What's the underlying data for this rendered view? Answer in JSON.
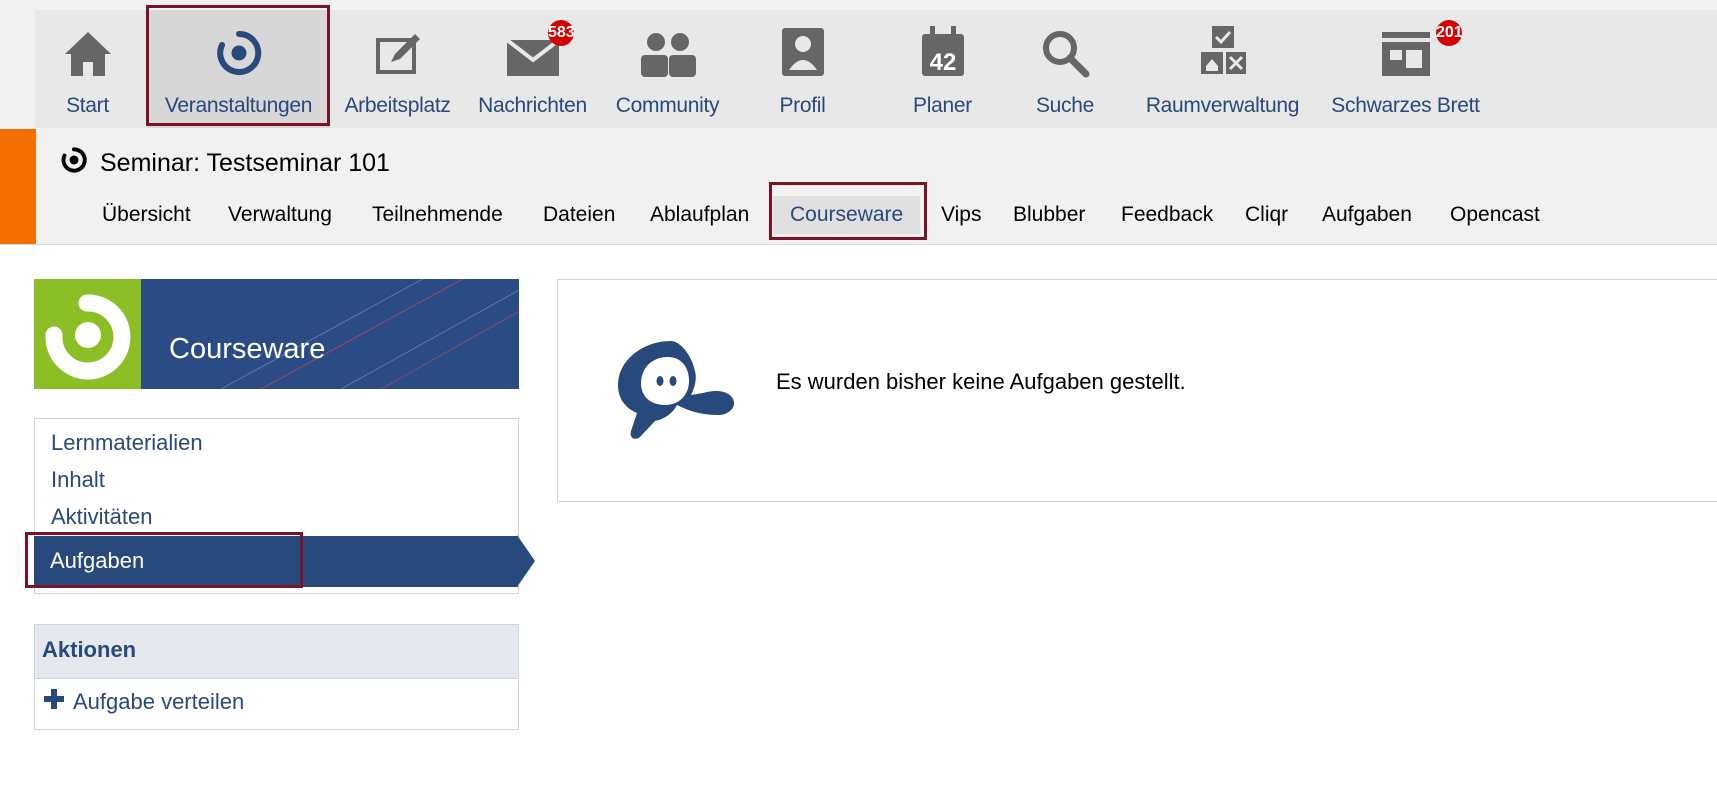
{
  "nav": {
    "items": [
      {
        "label": "Start",
        "icon": "home-icon"
      },
      {
        "label": "Veranstaltungen",
        "icon": "courses-icon",
        "active": true
      },
      {
        "label": "Arbeitsplatz",
        "icon": "workplace-icon"
      },
      {
        "label": "Nachrichten",
        "icon": "mail-icon",
        "badge": "583"
      },
      {
        "label": "Community",
        "icon": "community-icon"
      },
      {
        "label": "Profil",
        "icon": "profile-icon"
      },
      {
        "label": "Planer",
        "icon": "calendar-icon",
        "icon_text": "42"
      },
      {
        "label": "Suche",
        "icon": "search-icon"
      },
      {
        "label": "Raumverwaltung",
        "icon": "room-management-icon"
      },
      {
        "label": "Schwarzes Brett",
        "icon": "bulletin-board-icon",
        "badge": "201"
      }
    ]
  },
  "course": {
    "title": "Seminar: Testseminar 101",
    "tabs": [
      "Übersicht",
      "Verwaltung",
      "Teilnehmende",
      "Dateien",
      "Ablaufplan",
      "Courseware",
      "Vips",
      "Blubber",
      "Feedback",
      "Cliqr",
      "Aufgaben",
      "Opencast"
    ],
    "active_tab": "Courseware"
  },
  "sidebar": {
    "banner_title": "Courseware",
    "nav": [
      "Lernmaterialien",
      "Inhalt",
      "Aktivitäten"
    ],
    "active_item": "Aufgaben",
    "actions_title": "Aktionen",
    "actions": [
      {
        "label": "Aufgabe verteilen",
        "icon": "plus-icon"
      }
    ]
  },
  "main": {
    "message": "Es wurden bisher keine Aufgaben gestellt."
  },
  "colors": {
    "primary": "#28497c",
    "accent_orange": "#f26e00",
    "courseware_green": "#8cbf26",
    "badge_red": "#d60000",
    "highlight": "#7a1228"
  }
}
